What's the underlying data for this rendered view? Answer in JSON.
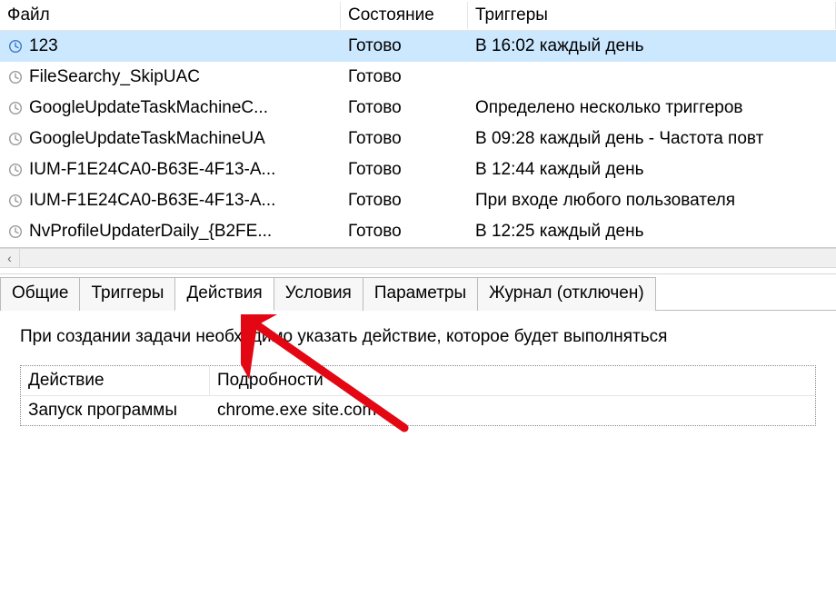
{
  "columns": {
    "file": "Файл",
    "state": "Состояние",
    "triggers": "Триггеры"
  },
  "tasks": [
    {
      "name": "123",
      "state": "Готово",
      "trigger": "В 16:02 каждый день",
      "selected": true,
      "iconColor": "#3a78c7"
    },
    {
      "name": "FileSearchy_SkipUAC",
      "state": "Готово",
      "trigger": "",
      "selected": false,
      "iconColor": "#9a9a9a"
    },
    {
      "name": "GoogleUpdateTaskMachineC...",
      "state": "Готово",
      "trigger": "Определено несколько триггеров",
      "selected": false,
      "iconColor": "#9a9a9a"
    },
    {
      "name": "GoogleUpdateTaskMachineUA",
      "state": "Готово",
      "trigger": "В 09:28 каждый день - Частота повт",
      "selected": false,
      "iconColor": "#9a9a9a"
    },
    {
      "name": "IUM-F1E24CA0-B63E-4F13-A...",
      "state": "Готово",
      "trigger": "В 12:44 каждый день",
      "selected": false,
      "iconColor": "#9a9a9a"
    },
    {
      "name": "IUM-F1E24CA0-B63E-4F13-A...",
      "state": "Готово",
      "trigger": "При входе любого пользователя",
      "selected": false,
      "iconColor": "#9a9a9a"
    },
    {
      "name": "NvProfileUpdaterDaily_{B2FE...",
      "state": "Готово",
      "trigger": "В 12:25 каждый день",
      "selected": false,
      "iconColor": "#9a9a9a"
    }
  ],
  "tabs": {
    "general": "Общие",
    "triggers": "Триггеры",
    "actions": "Действия",
    "conditions": "Условия",
    "settings": "Параметры",
    "history": "Журнал (отключен)"
  },
  "activeTab": "actions",
  "instruction": "При создании задачи необходимо указать действие, которое будет выполняться",
  "actionTable": {
    "headers": {
      "action": "Действие",
      "details": "Подробности"
    },
    "rows": [
      {
        "action": "Запуск программы",
        "details": "chrome.exe site.com"
      }
    ]
  },
  "annotation": {
    "arrowColor": "#e30613"
  }
}
